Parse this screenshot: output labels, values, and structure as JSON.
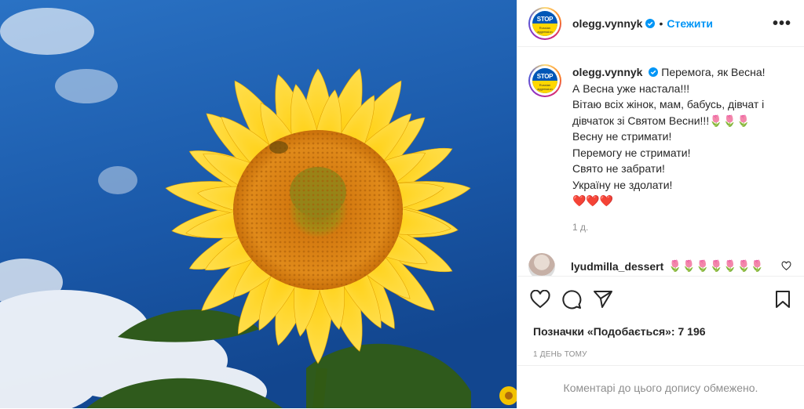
{
  "post": {
    "username": "olegg.vynnyk",
    "follow_label": "Стежити",
    "separator": "•",
    "more_label": "•••",
    "avatar_badge_text": "STOP",
    "avatar_badge_sub": "Russian aggression"
  },
  "caption": {
    "username": "olegg.vynnyk",
    "lines": [
      "Перемога, як Весна!",
      "А Весна уже настала!!!",
      "Вітаю всіх жінок, мам, бабусь, дівчат і дівчаток зі Святом Весни!!!🌷🌷🌷",
      "Весну не стримати!",
      "Перемогу не стримати!",
      "Свято не забрати!",
      "Україну не здолати!",
      "❤️❤️❤️"
    ],
    "time": "1 д."
  },
  "comment": {
    "username": "lyudmilla_dessert",
    "text": "🌷🌷🌷🌷🌷🌷🌷"
  },
  "actions": {
    "likes_label": "Позначки «Подобається»: 7 196",
    "date_label": "1 ДЕНЬ ТОМУ"
  },
  "footer": {
    "comments_limited": "Коментарі до цього допису обмежено."
  },
  "colors": {
    "accent": "#0095f6",
    "muted": "#8e8e8e",
    "sky": "#1c5fb0",
    "petal": "#f7c600"
  }
}
